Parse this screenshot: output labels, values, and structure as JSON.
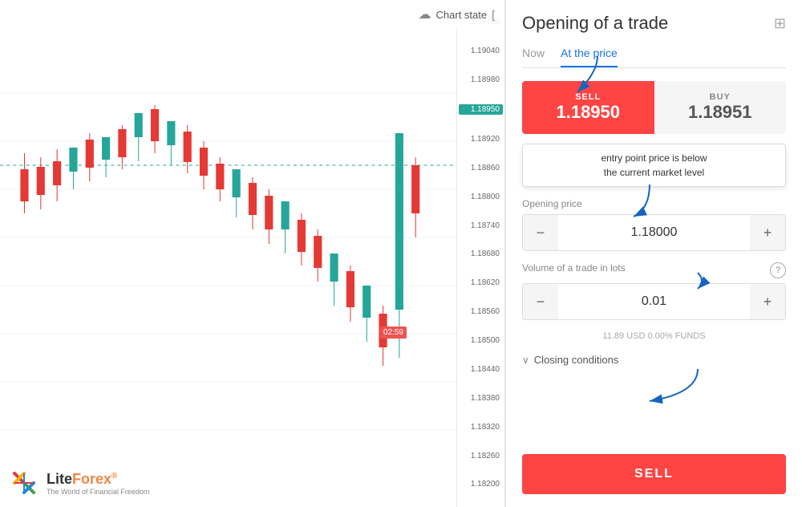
{
  "chart": {
    "toolbar": {
      "cloud_icon": "☁",
      "state_label": "Chart state"
    },
    "price_levels": [
      "1.19100",
      "1.19040",
      "1.18980",
      "1.18950",
      "1.18920",
      "1.18860",
      "1.18800",
      "1.18740",
      "1.18680",
      "1.18620",
      "1.18560",
      "1.18500",
      "1.18440",
      "1.18380",
      "1.18320",
      "1.18260",
      "1.18200"
    ],
    "highlighted_price": "1.18950",
    "time_label": "02:59"
  },
  "panel": {
    "title": "Opening of a trade",
    "expand_icon": "⊞",
    "tabs": [
      {
        "id": "now",
        "label": "Now",
        "active": false
      },
      {
        "id": "at_price",
        "label": "At the price",
        "active": true
      }
    ],
    "sell": {
      "label": "SELL",
      "price": "1.18950"
    },
    "buy": {
      "label": "BUY",
      "price": "1.18951"
    },
    "tooltip": {
      "line1": "entry point price is below",
      "line2": "the current market level"
    },
    "opening_price": {
      "label": "Opening price",
      "value": "1.18000",
      "minus": "−",
      "plus": "+"
    },
    "volume": {
      "label": "Volume of a trade in lots",
      "value": "0.01",
      "minus": "−",
      "plus": "+",
      "info": "11.89 USD   0.00% FUNDS"
    },
    "closing_conditions": {
      "label": "Closing conditions",
      "chevron": "∨"
    },
    "sell_button_label": "SELL"
  },
  "logo": {
    "name_lite": "Lite",
    "name_forex": "Forex",
    "reg": "®",
    "tagline": "The World of Financial Freedom"
  }
}
